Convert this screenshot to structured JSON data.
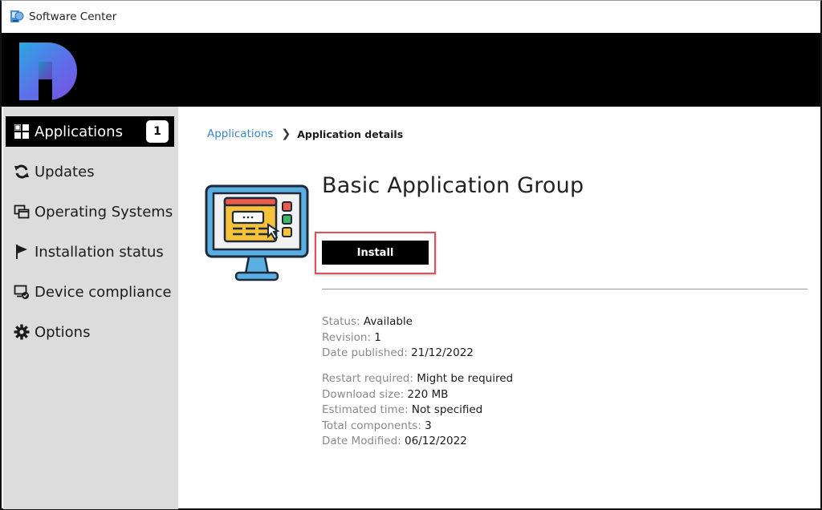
{
  "window": {
    "title": "Software Center"
  },
  "sidebar": {
    "items": [
      {
        "label": "Applications",
        "icon": "applications-grid-icon",
        "badge": "1",
        "active": true
      },
      {
        "label": "Updates",
        "icon": "refresh-icon",
        "active": false
      },
      {
        "label": "Operating Systems",
        "icon": "windows-stack-icon",
        "active": false
      },
      {
        "label": "Installation status",
        "icon": "flag-icon",
        "active": false
      },
      {
        "label": "Device compliance",
        "icon": "device-check-icon",
        "active": false
      },
      {
        "label": "Options",
        "icon": "gear-icon",
        "active": false
      }
    ]
  },
  "breadcrumb": {
    "parent": "Applications",
    "separator": "❯",
    "current": "Application details"
  },
  "app": {
    "name": "Basic Application Group",
    "install_label": "Install",
    "details_group1": [
      {
        "label": "Status:",
        "value": "Available"
      },
      {
        "label": "Revision:",
        "value": "1"
      },
      {
        "label": "Date published:",
        "value": "21/12/2022"
      }
    ],
    "details_group2": [
      {
        "label": "Restart required:",
        "value": "Might be required"
      },
      {
        "label": "Download size:",
        "value": "220 MB"
      },
      {
        "label": "Estimated time:",
        "value": "Not specified"
      },
      {
        "label": "Total components:",
        "value": "3"
      },
      {
        "label": "Date Modified:",
        "value": "06/12/2022"
      }
    ]
  },
  "colors": {
    "accent_link": "#3c88c8",
    "highlight_border": "#e0505a",
    "sidebar_bg": "#dcdcdc",
    "banner_bg": "#000000"
  }
}
